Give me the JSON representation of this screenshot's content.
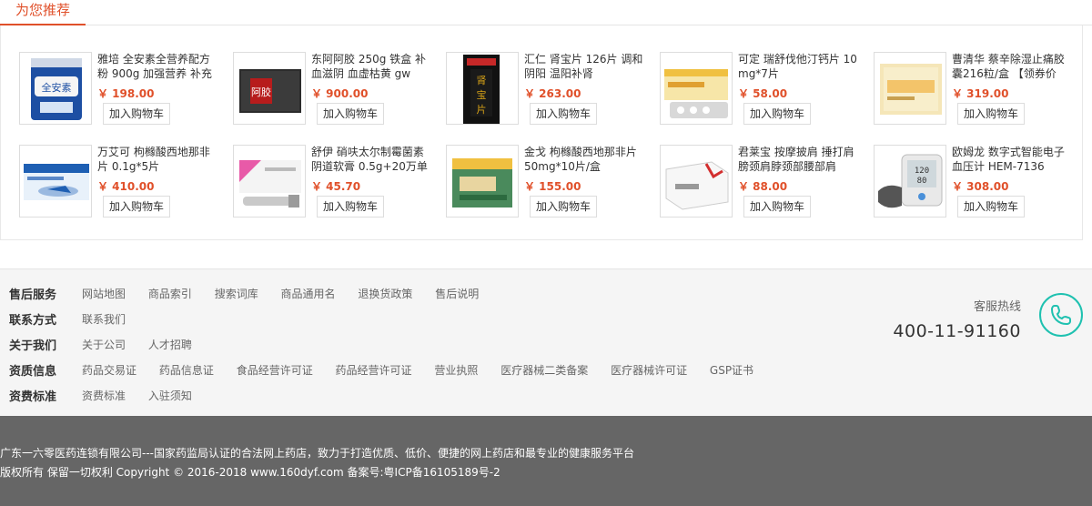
{
  "recommend": {
    "title": "为您推荐",
    "cart_label": "加入购物车",
    "products": [
      {
        "name": "雅培 全安素全营养配方粉 900g 加强营养 补充",
        "price": "￥ 198.00",
        "icon": "milk-powder-can"
      },
      {
        "name": "东阿阿胶 250g 铁盒 补血滋阴 血虚枯黄 gw",
        "price": "￥ 900.00",
        "icon": "ejiao-box"
      },
      {
        "name": "汇仁 肾宝片 126片 调和阴阳 温阳补肾",
        "price": "￥ 263.00",
        "icon": "shenbao-box"
      },
      {
        "name": "可定 瑞舒伐他汀钙片 10mg*7片",
        "price": "￥ 58.00",
        "icon": "tablet-box"
      },
      {
        "name": "曹清华 蔡辛除湿止痛胶囊216粒/盒 【领券价",
        "price": "￥ 319.00",
        "icon": "capsule-box"
      },
      {
        "name": "万艾可 枸橼酸西地那非片 0.1g*5片",
        "price": "￥ 410.00",
        "icon": "viagra-box"
      },
      {
        "name": "舒伊 硝呋太尔制霉菌素阴道软膏 0.5g+20万单",
        "price": "￥ 45.70",
        "icon": "ointment-box"
      },
      {
        "name": "金戈 枸橼酸西地那非片 50mg*10片/盒",
        "price": "￥ 155.00",
        "icon": "jinge-box"
      },
      {
        "name": "君莱宝 按摩披肩 捶打肩膀颈肩脖颈部腰部肩",
        "price": "￥ 88.00",
        "icon": "massager-box"
      },
      {
        "name": "欧姆龙 数字式智能电子血压计 HEM-7136",
        "price": "￥ 308.00",
        "icon": "blood-pressure-monitor"
      }
    ]
  },
  "footer": {
    "rows": [
      {
        "title": "售后服务",
        "links": [
          "网站地图",
          "商品索引",
          "搜索词库",
          "商品通用名",
          "退换货政策",
          "售后说明"
        ]
      },
      {
        "title": "联系方式",
        "links": [
          "联系我们"
        ]
      },
      {
        "title": "关于我们",
        "links": [
          "关于公司",
          "人才招聘"
        ]
      },
      {
        "title": "资质信息",
        "links": [
          "药品交易证",
          "药品信息证",
          "食品经营许可证",
          "药品经营许可证",
          "营业执照",
          "医疗器械二类备案",
          "医疗器械许可证",
          "GSP证书"
        ]
      },
      {
        "title": "资费标准",
        "links": [
          "资费标准",
          "入驻须知"
        ]
      }
    ],
    "hotline_label": "客服热线",
    "hotline_number": "400-11-91160",
    "copyright_line1": "广东一六零医药连锁有限公司---国家药监局认证的合法网上药店，致力于打造优质、低价、便捷的网上药店和最专业的健康服务平台",
    "copyright_line2": "版权所有 保留一切权利 Copyright © 2016-2018 www.160dyf.com 备案号:粤ICP备16105189号-2"
  },
  "colors": {
    "accent": "#e0502a",
    "phone": "#1fc1b0",
    "band": "#666666"
  }
}
